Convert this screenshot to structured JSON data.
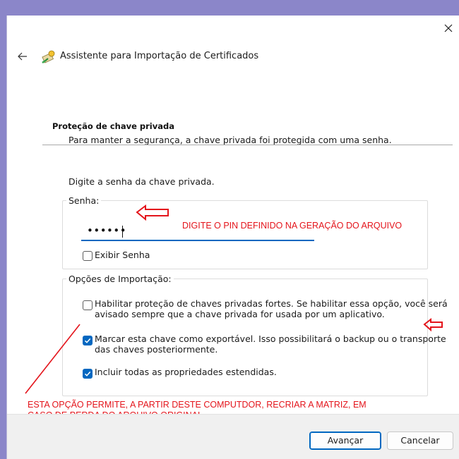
{
  "window": {
    "title": "Assistente para Importação de Certificados"
  },
  "section": {
    "heading": "Proteção de chave privada",
    "description": "Para manter a segurança, a chave privada foi protegida com uma senha."
  },
  "password_prompt": "Digite a senha da chave privada.",
  "password_group": {
    "legend": "Senha:",
    "value_masked": "••••••",
    "show_password": {
      "label": "Exibir Senha",
      "checked": false
    }
  },
  "import_options": {
    "legend": "Opções de Importação:",
    "items": [
      {
        "label_line1": "Habilitar proteção de chaves privadas fortes. Se habilitar essa opção, você será",
        "label_line2": "avisado sempre que a chave privada for usada por um aplicativo.",
        "checked": false
      },
      {
        "label_line1": "Marcar esta chave como exportável. Isso possibilitará o backup ou o transporte",
        "label_line2": "das chaves posteriormente.",
        "checked": true
      },
      {
        "label_line1": "Incluir todas as propriedades estendidas.",
        "label_line2": "",
        "checked": true
      }
    ]
  },
  "annotations": {
    "pin_note": "DIGITE O PIN DEFINIDO NA GERAÇÃO DO ARQUIVO",
    "option_note_line1": "ESTA OPÇÃO PERMITE, A PARTIR DESTE COMPUTDOR, RECRIAR A MATRIZ, EM",
    "option_note_line2": "CASO DE PERDA DO ARQUIVO ORIGINAL",
    "color": "#e4141b"
  },
  "buttons": {
    "next": "Avançar",
    "cancel": "Cancelar"
  },
  "colors": {
    "accent": "#0067c0",
    "backdrop": "#8b86c9"
  }
}
